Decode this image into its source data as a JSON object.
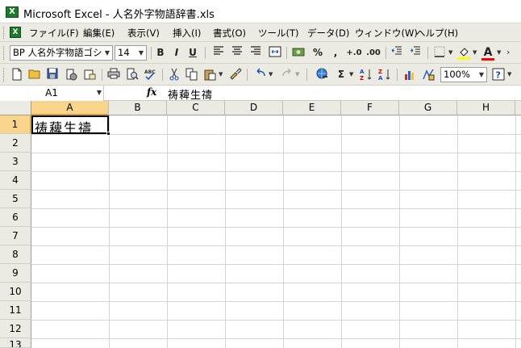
{
  "window": {
    "title": "Microsoft Excel - 人名外字物語辞書.xls",
    "app_icon": "excel-icon"
  },
  "menubar": {
    "doc_icon": "excel-doc-icon",
    "items": [
      {
        "label": "ファイル(F)"
      },
      {
        "label": "編集(E)"
      },
      {
        "label": "表示(V)"
      },
      {
        "label": "挿入(I)"
      },
      {
        "label": "書式(O)"
      },
      {
        "label": "ツール(T)"
      },
      {
        "label": "データ(D)"
      },
      {
        "label": "ウィンドウ(W)"
      },
      {
        "label": "ヘルプ(H)"
      }
    ]
  },
  "format_toolbar": {
    "font_name": "BP 人名外字物語ゴシ",
    "font_size": "14",
    "bold": "B",
    "italic": "I",
    "underline": "U",
    "percent": "%",
    "comma": ",",
    "inc_decimal": "+.0",
    "dec_decimal": ".00",
    "fill_color": "#ffff00",
    "font_color_label": "A",
    "font_color": "#ff0000"
  },
  "standard_toolbar": {
    "autosum": "Σ",
    "zoom": "100%"
  },
  "formula_bar": {
    "name_box": "A1",
    "fx_label": "fx",
    "content": "祷薭生禱"
  },
  "sheet": {
    "columns": [
      "A",
      "B",
      "C",
      "D",
      "E",
      "F",
      "G",
      "H"
    ],
    "rows": [
      "1",
      "2",
      "3",
      "4",
      "5",
      "6",
      "7",
      "8",
      "9",
      "10",
      "11",
      "12",
      "13"
    ],
    "active_cell": "A1",
    "cell_A1": "祷薭生禱"
  }
}
